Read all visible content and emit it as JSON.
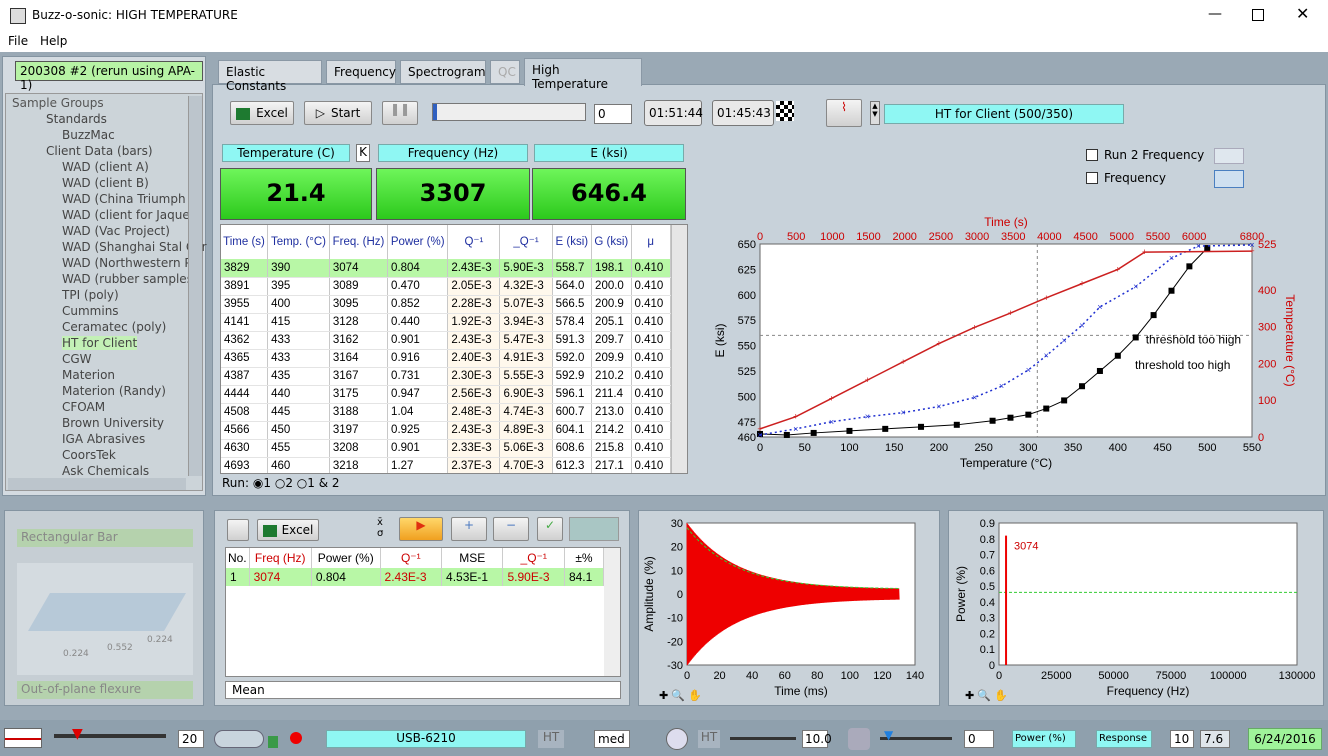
{
  "window": {
    "title": "Buzz-o-sonic: HIGH TEMPERATURE"
  },
  "menu": [
    "File",
    "Help"
  ],
  "sample_name": "200308 #2 (rerun using APA-1)",
  "tree": {
    "header": "Sample Groups",
    "items": [
      {
        "label": "Standards",
        "lvl": 1
      },
      {
        "label": "BuzzMac",
        "lvl": 2
      },
      {
        "label": "Client Data (bars)",
        "lvl": 1
      },
      {
        "label": "WAD (client A)",
        "lvl": 2
      },
      {
        "label": "WAD (client B)",
        "lvl": 2
      },
      {
        "label": "WAD (China Triumph In",
        "lvl": 2
      },
      {
        "label": "WAD (client for Jaques)",
        "lvl": 2
      },
      {
        "label": "WAD (Vac Project)",
        "lvl": 2
      },
      {
        "label": "WAD (Shanghai Stal Cor",
        "lvl": 2
      },
      {
        "label": "WAD (Northwestern Pol",
        "lvl": 2
      },
      {
        "label": "WAD (rubber samples)",
        "lvl": 2
      },
      {
        "label": "TPI (poly)",
        "lvl": 2
      },
      {
        "label": "Cummins",
        "lvl": 2
      },
      {
        "label": "Ceramatec (poly)",
        "lvl": 2
      },
      {
        "label": "HT for Client",
        "lvl": 2,
        "selected": true
      },
      {
        "label": "CGW",
        "lvl": 2
      },
      {
        "label": "Materion",
        "lvl": 2
      },
      {
        "label": "Materion (Randy)",
        "lvl": 2
      },
      {
        "label": "CFOAM",
        "lvl": 2
      },
      {
        "label": "Brown University",
        "lvl": 2
      },
      {
        "label": "IGA Abrasives",
        "lvl": 2
      },
      {
        "label": "CoorsTek",
        "lvl": 2
      },
      {
        "label": "Ask Chemicals",
        "lvl": 2
      }
    ]
  },
  "tabs": [
    "Elastic Constants",
    "Frequency",
    "Spectrogram",
    "QC",
    "High Temperature"
  ],
  "toolbar": {
    "excel": "Excel",
    "start": "Start",
    "counter": "0",
    "elapsed": "01:51:44",
    "remaining": "01:45:43",
    "profile": "HT for Client (500/350)"
  },
  "readouts": {
    "temp_label": "Temperature (C)",
    "unit": "K",
    "freq_label": "Frequency (Hz)",
    "e_label": "E (ksi)",
    "temp": "21.4",
    "freq": "3307",
    "e": "646.4"
  },
  "run_table": {
    "headers": [
      "Time (s)",
      "Temp. (°C)",
      "Freq. (Hz)",
      "Power (%)",
      "Q⁻¹",
      "_Q⁻¹",
      "E (ksi)",
      "G (ksi)",
      "μ"
    ],
    "rows": [
      [
        "3829",
        "390",
        "3074",
        "0.804",
        "2.43E-3",
        "5.90E-3",
        "558.7",
        "198.1",
        "0.410"
      ],
      [
        "3891",
        "395",
        "3089",
        "0.470",
        "2.05E-3",
        "4.32E-3",
        "564.0",
        "200.0",
        "0.410"
      ],
      [
        "3955",
        "400",
        "3095",
        "0.852",
        "2.28E-3",
        "5.07E-3",
        "566.5",
        "200.9",
        "0.410"
      ],
      [
        "4141",
        "415",
        "3128",
        "0.440",
        "1.92E-3",
        "3.94E-3",
        "578.4",
        "205.1",
        "0.410"
      ],
      [
        "4362",
        "433",
        "3162",
        "0.901",
        "2.43E-3",
        "5.47E-3",
        "591.3",
        "209.7",
        "0.410"
      ],
      [
        "4365",
        "433",
        "3164",
        "0.916",
        "2.40E-3",
        "4.91E-3",
        "592.0",
        "209.9",
        "0.410"
      ],
      [
        "4387",
        "435",
        "3167",
        "0.731",
        "2.30E-3",
        "5.55E-3",
        "592.9",
        "210.2",
        "0.410"
      ],
      [
        "4444",
        "440",
        "3175",
        "0.947",
        "2.56E-3",
        "6.90E-3",
        "596.1",
        "211.4",
        "0.410"
      ],
      [
        "4508",
        "445",
        "3188",
        "1.04",
        "2.48E-3",
        "4.74E-3",
        "600.7",
        "213.0",
        "0.410"
      ],
      [
        "4566",
        "450",
        "3197",
        "0.925",
        "2.43E-3",
        "4.89E-3",
        "604.1",
        "214.2",
        "0.410"
      ],
      [
        "4630",
        "455",
        "3208",
        "0.901",
        "2.33E-3",
        "5.06E-3",
        "608.6",
        "215.8",
        "0.410"
      ],
      [
        "4693",
        "460",
        "3218",
        "1.27",
        "2.37E-3",
        "4.70E-3",
        "612.3",
        "217.1",
        "0.410"
      ]
    ]
  },
  "run_selector": {
    "label": "Run:",
    "opts": [
      "1",
      "2",
      "1 & 2"
    ]
  },
  "ht_options": {
    "run2": "Run 2 Frequency",
    "freq": "Frequency"
  },
  "chart_data": [
    {
      "type": "scatter",
      "title": "",
      "xlabel": "Temperature (°C)",
      "ylabel": "E (ksi)",
      "x2label": "Time (s)",
      "y2label": "Temperature (°C)",
      "xlim": [
        0,
        550
      ],
      "ylim": [
        460,
        650
      ],
      "x2lim": [
        0,
        6800
      ],
      "y2lim": [
        0,
        525
      ],
      "xticks": [
        0,
        50,
        100,
        150,
        200,
        250,
        300,
        350,
        400,
        450,
        500,
        550
      ],
      "yticks": [
        460,
        475,
        500,
        525,
        550,
        575,
        600,
        625,
        650
      ],
      "x2ticks": [
        0,
        500,
        1000,
        1500,
        2000,
        2500,
        3000,
        3500,
        4000,
        4500,
        5000,
        5500,
        6000,
        6800
      ],
      "y2ticks": [
        0,
        100,
        200,
        300,
        400,
        525
      ],
      "cursor": {
        "x": 310,
        "y": 560
      },
      "annotations": [
        {
          "text": "threshold too high",
          "x": 420,
          "y": 557
        },
        {
          "text": "threshold too high",
          "x": 408,
          "y": 532
        }
      ],
      "series": [
        {
          "color": "#000000",
          "points": [
            [
              0,
              463
            ],
            [
              30,
              462
            ],
            [
              60,
              464
            ],
            [
              100,
              466
            ],
            [
              140,
              468
            ],
            [
              180,
              470
            ],
            [
              220,
              472
            ],
            [
              260,
              476
            ],
            [
              280,
              479
            ],
            [
              300,
              482
            ],
            [
              320,
              488
            ],
            [
              340,
              496
            ],
            [
              360,
              510
            ],
            [
              380,
              525
            ],
            [
              400,
              540
            ],
            [
              420,
              558
            ],
            [
              440,
              580
            ],
            [
              460,
              604
            ],
            [
              480,
              628
            ],
            [
              500,
              646
            ]
          ]
        },
        {
          "color": "#2030d0",
          "points": [
            [
              0,
              462
            ],
            [
              40,
              468
            ],
            [
              80,
              475
            ],
            [
              120,
              480
            ],
            [
              160,
              484
            ],
            [
              200,
              490
            ],
            [
              240,
              499
            ],
            [
              270,
              510
            ],
            [
              300,
              526
            ],
            [
              320,
              540
            ],
            [
              340,
              555
            ],
            [
              360,
              570
            ],
            [
              380,
              588
            ],
            [
              420,
              608
            ],
            [
              460,
              636
            ],
            [
              490,
              648
            ],
            [
              550,
              649
            ]
          ]
        },
        {
          "color": "#cc2020",
          "points": [
            [
              0,
              468
            ],
            [
              40,
              480
            ],
            [
              80,
              498
            ],
            [
              120,
              516
            ],
            [
              160,
              534
            ],
            [
              200,
              552
            ],
            [
              240,
              568
            ],
            [
              280,
              582
            ],
            [
              320,
              597
            ],
            [
              360,
              611
            ],
            [
              400,
              625
            ],
            [
              430,
              642
            ],
            [
              550,
              643
            ]
          ]
        }
      ]
    },
    {
      "type": "line",
      "xlabel": "Time (ms)",
      "ylabel": "Amplitude (%)",
      "xlim": [
        0,
        140
      ],
      "ylim": [
        -30,
        30
      ],
      "xticks": [
        0,
        20,
        40,
        60,
        80,
        100,
        120,
        140
      ],
      "yticks": [
        -30,
        -20,
        -10,
        0,
        10,
        20,
        30
      ]
    },
    {
      "type": "bar",
      "xlabel": "Frequency (Hz)",
      "ylabel": "Power (%)",
      "xlim": [
        0,
        130000
      ],
      "ylim": [
        0,
        0.9
      ],
      "xticks": [
        0,
        25000,
        50000,
        75000,
        100000,
        130000
      ],
      "yticks": [
        0,
        0.1,
        0.2,
        0.3,
        0.4,
        0.5,
        0.6,
        0.7,
        0.8,
        0.9
      ],
      "peak_label": "3074",
      "peak_x": 3074,
      "peak_y": 0.82
    }
  ],
  "fit_table": {
    "excel": "Excel",
    "headers": [
      "No.",
      "Freq (Hz)",
      "Power (%)",
      "Q⁻¹",
      "MSE",
      "_Q⁻¹",
      "±%"
    ],
    "row": [
      "1",
      "3074",
      "0.804",
      "2.43E-3",
      "4.53E-1",
      "5.90E-3",
      "84.1"
    ],
    "mean": "Mean"
  },
  "shape": {
    "name": "Rectangular Bar",
    "mode": "Out-of-plane flexure",
    "dims": [
      "0.224",
      "0.552",
      "0.224"
    ]
  },
  "status": {
    "n": "20",
    "daq": "USB-6210",
    "ht": "HT",
    "speed": "med",
    "ht2": "HT",
    "ten": "10.0",
    "zero": "0",
    "power": "Power (%)",
    "response": "Response",
    "r10": "10",
    "r76": "7.6",
    "date": "6/24/2016"
  }
}
